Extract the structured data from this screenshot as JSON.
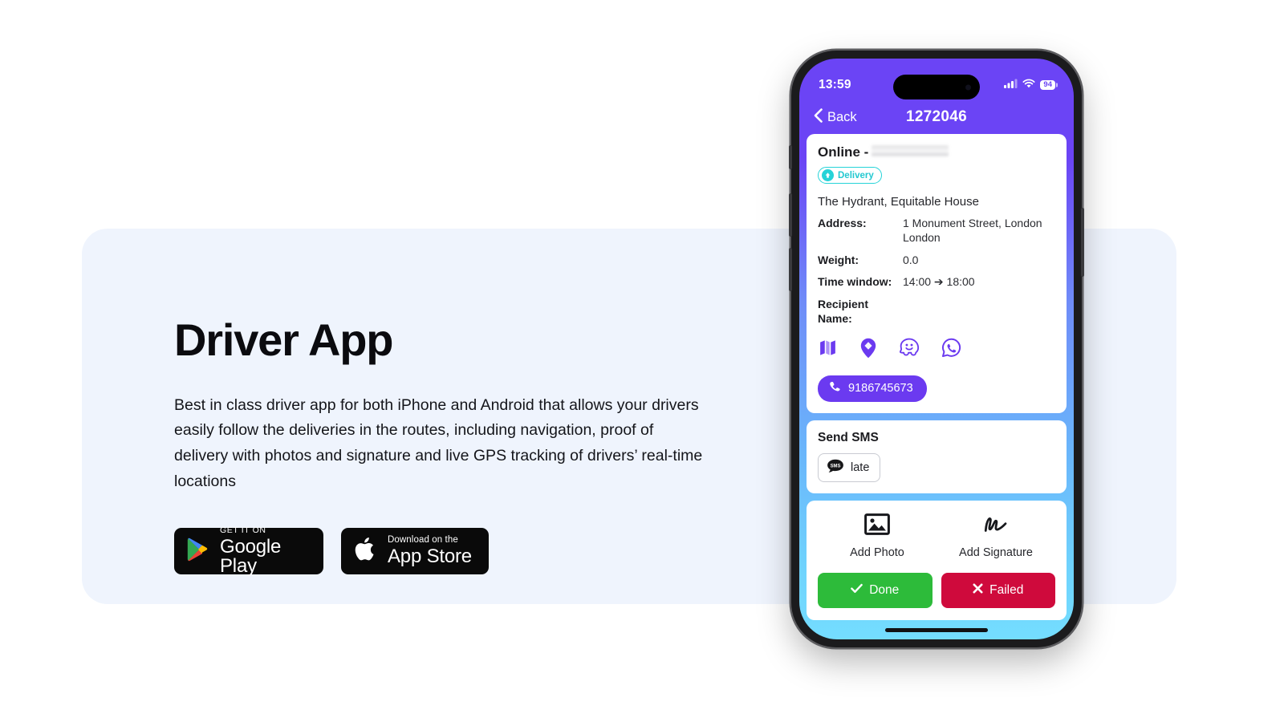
{
  "hero": {
    "title": "Driver App",
    "description": "Best in class driver app for both iPhone and Android that allows your drivers easily follow the deliveries in the routes, including navigation, proof of delivery with photos and signature and live GPS tracking of drivers’ real-time locations",
    "badges": [
      {
        "id": "google-play",
        "small": "GET IT ON",
        "large": "Google Play",
        "icon": "google-play-icon"
      },
      {
        "id": "app-store",
        "small": "Download on the",
        "large": "App Store",
        "icon": "apple-logo-icon"
      }
    ]
  },
  "phone": {
    "status_bar": {
      "time": "13:59",
      "cellular_icon": "cellular-signal-icon",
      "wifi_icon": "wifi-icon",
      "battery_level": "94"
    },
    "nav": {
      "back_label": "Back",
      "back_icon": "chevron-left-icon",
      "title": "1272046"
    },
    "details_card": {
      "order_title_prefix": "Online - ",
      "order_title_redacted": "",
      "badge_label": "Delivery",
      "badge_icon": "arrow-up-circle-icon",
      "badge_color": "#22c8d0",
      "place_name": "The Hydrant, Equitable House",
      "rows": [
        {
          "label": "Address:",
          "value": "1 Monument Street, London  London"
        },
        {
          "label": "Weight:",
          "value": "0.0"
        },
        {
          "label": "Time window:",
          "value": "14:00 ➔ 18:00"
        },
        {
          "label": "Recipient Name:",
          "value": ""
        }
      ],
      "nav_icons": [
        {
          "name": "map-icon"
        },
        {
          "name": "google-maps-pin-icon"
        },
        {
          "name": "waze-icon"
        },
        {
          "name": "whatsapp-icon"
        }
      ],
      "phone_number": "9186745673",
      "phone_icon": "phone-handset-icon",
      "accent_color": "#6b3af0"
    },
    "sms_card": {
      "title": "Send SMS",
      "button_label": "late",
      "button_icon": "sms-bubble-icon"
    },
    "proof_card": {
      "actions": [
        {
          "label": "Add Photo",
          "icon": "photo-icon"
        },
        {
          "label": "Add Signature",
          "icon": "signature-icon"
        }
      ],
      "done_label": "Done",
      "done_icon": "check-icon",
      "done_color": "#2dbb3a",
      "failed_label": "Failed",
      "failed_icon": "cross-icon",
      "failed_color": "#cf0a3c"
    }
  }
}
